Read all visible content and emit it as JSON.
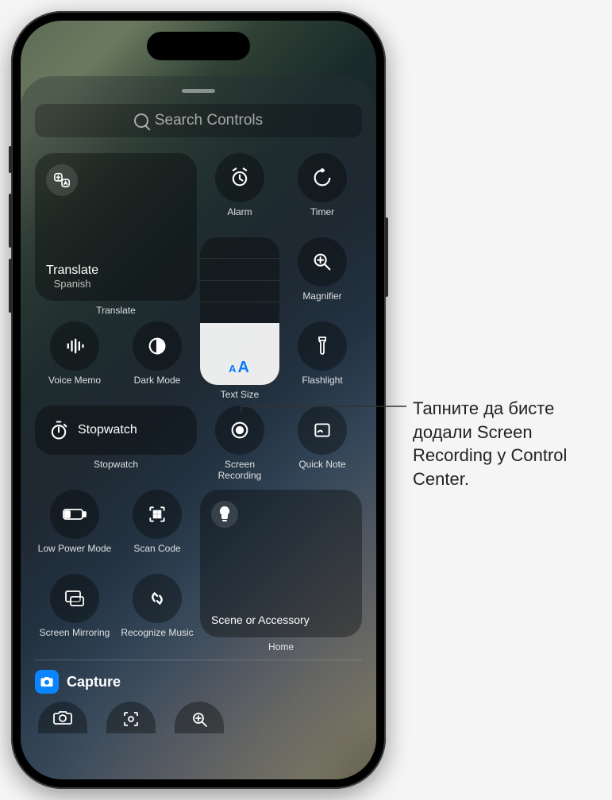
{
  "search": {
    "placeholder": "Search Controls"
  },
  "translate": {
    "title": "Translate",
    "subtitle": "Spanish",
    "label": "Translate"
  },
  "controls": {
    "alarm": "Alarm",
    "timer": "Timer",
    "magnifier": "Magnifier",
    "voice_memo": "Voice Memo",
    "dark_mode": "Dark Mode",
    "text_size": "Text Size",
    "flashlight": "Flashlight",
    "stopwatch_inline": "Stopwatch",
    "stopwatch": "Stopwatch",
    "screen_recording": "Screen Recording",
    "quick_note": "Quick Note",
    "low_power_mode": "Low Power Mode",
    "scan_code": "Scan Code",
    "screen_mirroring": "Screen Mirroring",
    "recognize_music": "Recognize Music"
  },
  "home": {
    "scene": "Scene or Accessory",
    "label": "Home"
  },
  "section": {
    "capture": "Capture"
  },
  "callout": "Тапните да бисте додали Screen Recording у Control Center."
}
